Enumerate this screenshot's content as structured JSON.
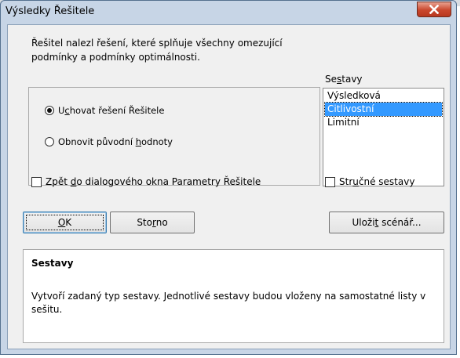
{
  "dialog": {
    "title": "Výsledky Řešitele",
    "message": "Řešitel nalezl řešení, které splňuje všechny omezující podmínky a podmínky optimálnosti."
  },
  "options": {
    "keep": {
      "pre": "U",
      "accel": "c",
      "post": "hovat řešení Řešitele",
      "checked": true
    },
    "restore": {
      "pre": "Obnovit původní ",
      "accel": "h",
      "post": "odnoty",
      "checked": false
    }
  },
  "checks": {
    "return_pre": "Zpět ",
    "return_accel": "d",
    "return_post": "o dialogového okna Parametry Řešitele",
    "outline_pre": "Str",
    "outline_accel": "u",
    "outline_post": "čné sestavy"
  },
  "reports": {
    "label_pre": "Se",
    "label_accel": "s",
    "label_post": "tavy",
    "items": [
      "Výsledková",
      "Citlivostní",
      "Limitní"
    ],
    "selected_index": 1
  },
  "buttons": {
    "ok_accel": "O",
    "ok_post": "K",
    "cancel_pre": "Sto",
    "cancel_accel": "r",
    "cancel_post": "no",
    "save_pre": "Uloži",
    "save_accel": "t",
    "save_post": " scénář..."
  },
  "info": {
    "title": "Sestavy",
    "text": "Vytvoří zadaný typ sestavy. Jednotlivé sestavy budou vloženy na samostatné listy v sešitu."
  },
  "colors": {
    "selection": "#3399ff",
    "close_button": "#c9472d",
    "window_frame": "#c7d5e6"
  }
}
